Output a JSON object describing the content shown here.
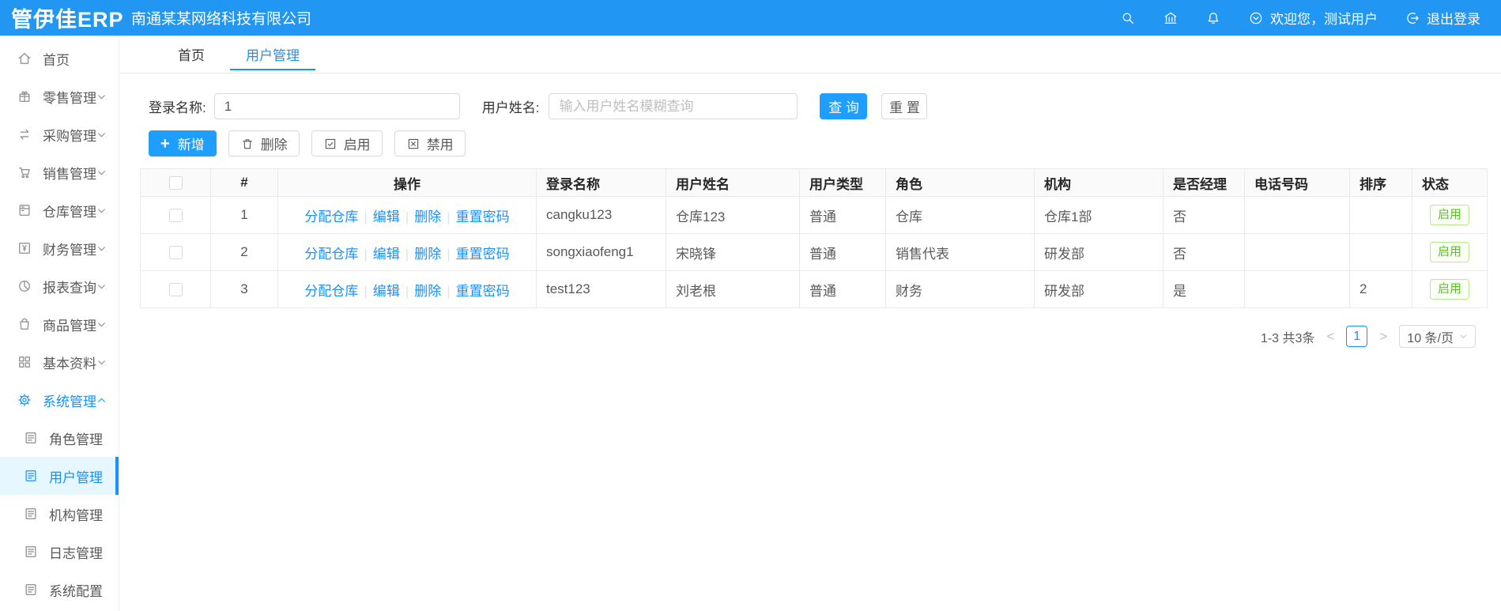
{
  "colors": {
    "header_bg": "#2196f3",
    "primary": "#1890ff",
    "button_blue": "#1e9fff",
    "active_menu_bg": "#e6f7ff",
    "status_green": "#52c41a",
    "status_green_border": "#b7eb8f",
    "table_border": "#e9e9e9"
  },
  "header": {
    "logo_text": "管伊佳ERP",
    "company_name": "南通某某网络科技有限公司",
    "welcome_text": "欢迎您，测试用户",
    "logout_text": "退出登录"
  },
  "sidebar": {
    "items": [
      {
        "label": "首页"
      },
      {
        "label": "零售管理"
      },
      {
        "label": "采购管理"
      },
      {
        "label": "销售管理"
      },
      {
        "label": "仓库管理"
      },
      {
        "label": "财务管理"
      },
      {
        "label": "报表查询"
      },
      {
        "label": "商品管理"
      },
      {
        "label": "基本资料"
      },
      {
        "label": "系统管理"
      }
    ],
    "system_subitems": [
      "角色管理",
      "用户管理",
      "机构管理",
      "日志管理",
      "系统配置"
    ],
    "active_item": "系统管理",
    "active_subitem": "用户管理"
  },
  "tabs": {
    "items": [
      {
        "label": "首页"
      },
      {
        "label": "用户管理"
      }
    ],
    "active": "用户管理"
  },
  "search": {
    "login_name_label": "登录名称:",
    "login_name_value": "1",
    "user_name_label": "用户姓名:",
    "user_name_placeholder": "输入用户姓名模糊查询",
    "query_button": "查 询",
    "reset_button": "重 置"
  },
  "toolbar": {
    "add_button": "新增",
    "delete_button": "删除",
    "enable_button": "启用",
    "disable_button": "禁用"
  },
  "table": {
    "headers": [
      "#",
      "操作",
      "登录名称",
      "用户姓名",
      "用户类型",
      "角色",
      "机构",
      "是否经理",
      "电话号码",
      "排序",
      "状态"
    ],
    "op_links": [
      "分配仓库",
      "编辑",
      "删除",
      "重置密码"
    ],
    "rows": [
      {
        "index": "1",
        "login": "cangku123",
        "name": "仓库123",
        "type": "普通",
        "role": "仓库",
        "org": "仓库1部",
        "manager": "否",
        "phone": "",
        "sort": "",
        "status": "启用"
      },
      {
        "index": "2",
        "login": "songxiaofeng1",
        "name": "宋晓锋",
        "type": "普通",
        "role": "销售代表",
        "org": "研发部",
        "manager": "否",
        "phone": "",
        "sort": "",
        "status": "启用"
      },
      {
        "index": "3",
        "login": "test123",
        "name": "刘老根",
        "type": "普通",
        "role": "财务",
        "org": "研发部",
        "manager": "是",
        "phone": "",
        "sort": "2",
        "status": "启用"
      }
    ]
  },
  "pagination": {
    "total_text": "1-3 共3条",
    "prev_arrow": "<",
    "current_page": "1",
    "next_arrow": ">",
    "page_size": "10 条/页"
  }
}
